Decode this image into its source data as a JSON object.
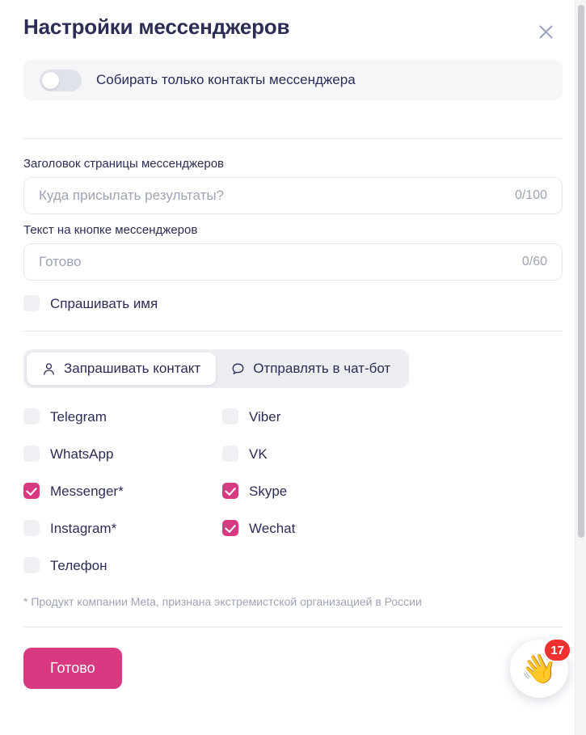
{
  "header": {
    "title": "Настройки мессенджеров",
    "close_icon": "close-icon"
  },
  "toggle": {
    "label": "Собирать только контакты мессенджера",
    "checked": false
  },
  "fields": {
    "page_title": {
      "label": "Заголовок страницы мессенджеров",
      "value": "",
      "placeholder": "Куда присылать результаты?",
      "counter": "0/100"
    },
    "button_text": {
      "label": "Текст на кнопке мессенджеров",
      "value": "",
      "placeholder": "Готово",
      "counter": "0/60"
    }
  },
  "ask_name": {
    "label": "Спрашивать имя",
    "checked": false
  },
  "tabs": [
    {
      "label": "Запрашивать контакт",
      "icon": "user-icon",
      "active": true
    },
    {
      "label": "Отправлять в чат-бот",
      "icon": "chat-bubble-icon",
      "active": false
    }
  ],
  "messengers": [
    {
      "label": "Telegram",
      "checked": false
    },
    {
      "label": "Viber",
      "checked": false
    },
    {
      "label": "WhatsApp",
      "checked": false
    },
    {
      "label": "VK",
      "checked": false
    },
    {
      "label": "Messenger*",
      "checked": true
    },
    {
      "label": "Skype",
      "checked": true
    },
    {
      "label": "Instagram*",
      "checked": false
    },
    {
      "label": "Wechat",
      "checked": true
    },
    {
      "label": "Телефон",
      "checked": false
    }
  ],
  "footnote": "* Продукт компании Meta, признана экстремистской организацией в России",
  "footer": {
    "submit_label": "Готово"
  },
  "help_widget": {
    "icon": "waving-hand-icon",
    "glyph": "👋",
    "badge_count": "17"
  },
  "colors": {
    "accent": "#d83a82",
    "text": "#2b2d55",
    "muted": "#9ea3b5",
    "badge": "#f13030",
    "field_border": "#e6e7ee",
    "checkbox_off": "#eef0f4"
  }
}
